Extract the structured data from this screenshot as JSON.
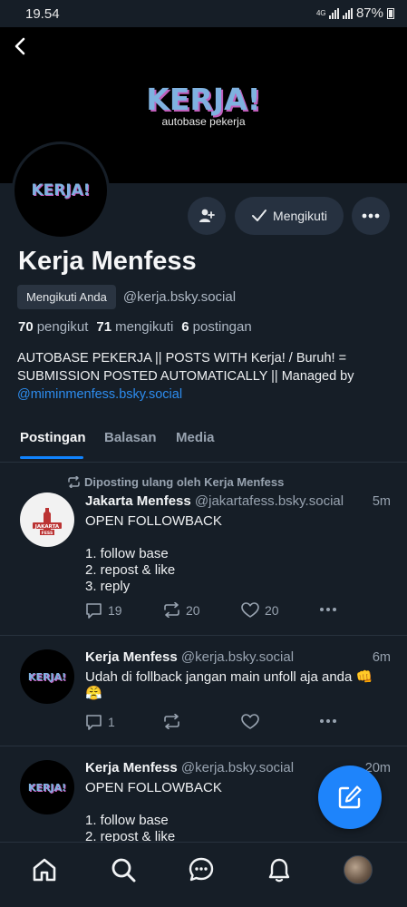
{
  "status": {
    "time": "19.54",
    "network": "4G",
    "battery": "87%"
  },
  "banner": {
    "title": "KERJA!",
    "subtitle": "autobase pekerja"
  },
  "avatar_text": "KERJA!",
  "actions": {
    "follow_label": "Mengikuti"
  },
  "profile": {
    "name": "Kerja Menfess",
    "follows_you": "Mengikuti Anda",
    "handle": "@kerja.bsky.social",
    "followers_count": "70",
    "followers_label": "pengikut",
    "following_count": "71",
    "following_label": "mengikuti",
    "posts_count": "6",
    "posts_label": "postingan",
    "bio": "AUTOBASE PEKERJA || POSTS WITH Kerja! / Buruh! = SUBMISSION POSTED AUTOMATICALLY || Managed by",
    "bio_link": "@miminmenfess.bsky.social"
  },
  "tabs": [
    {
      "label": "Postingan",
      "active": true
    },
    {
      "label": "Balasan",
      "active": false
    },
    {
      "label": "Media",
      "active": false
    }
  ],
  "posts": [
    {
      "repost_by": "Diposting ulang oleh Kerja Menfess",
      "author": "Jakarta Menfess",
      "handle": "@jakartafess.bsky.social",
      "time": "5m",
      "text": "OPEN FOLLOWBACK\n\n1. follow base\n2. repost & like\n3. reply",
      "replies": "19",
      "reposts": "20",
      "likes": "20",
      "avatar_text": "JAKARTA FESS"
    },
    {
      "author": "Kerja Menfess",
      "handle": "@kerja.bsky.social",
      "time": "6m",
      "text": "Udah di follback jangan main unfoll aja anda 👊\n😤",
      "replies": "1",
      "reposts": "",
      "likes": "",
      "avatar_text": "KERJA!"
    },
    {
      "author": "Kerja Menfess",
      "handle": "@kerja.bsky.social",
      "time": "20m",
      "text": "OPEN FOLLOWBACK\n\n1. follow base\n2. repost & like",
      "avatar_text": "KERJA!"
    }
  ],
  "colors": {
    "background": "#161e27",
    "accent": "#1083fe",
    "link": "#2d8df0",
    "fab": "#1e84fb"
  },
  "icons": [
    "back-arrow-icon",
    "add-person-icon",
    "checkmark-icon",
    "more-icon",
    "repost-icon",
    "reply-icon",
    "like-icon",
    "compose-icon",
    "home-icon",
    "search-icon",
    "chat-icon",
    "bell-icon"
  ]
}
